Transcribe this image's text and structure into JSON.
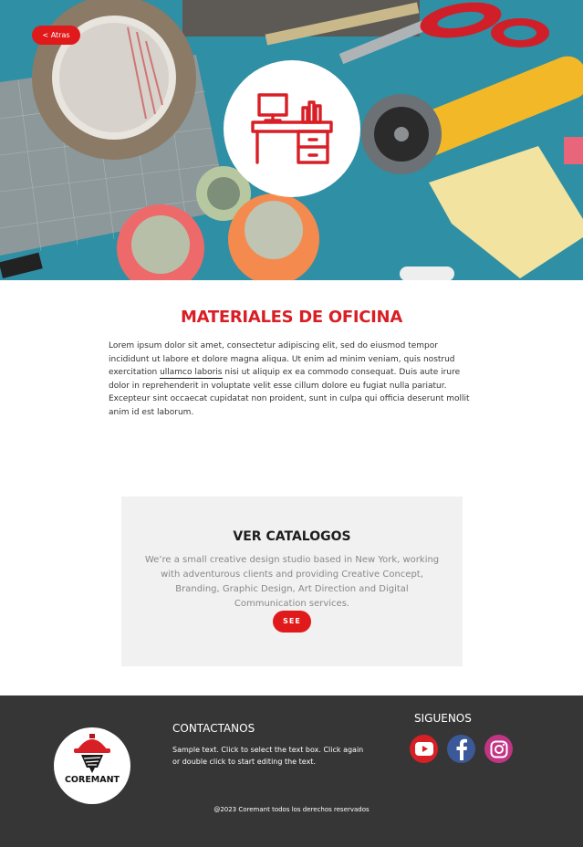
{
  "hero": {
    "back_label": "< Atras"
  },
  "content": {
    "title": "MATERIALES DE OFICINA",
    "paragraph_start": "Lorem ipsum dolor sit amet, consectetur adipiscing elit, sed do eiusmod tempor incididunt ut labore et dolore magna aliqua. Ut enim ad minim veniam, quis nostrud exercitation ",
    "paragraph_link": "ullamco laboris",
    "paragraph_end": " nisi ut aliquip ex ea commodo consequat. Duis aute irure dolor in reprehenderit in voluptate velit esse cillum dolore eu fugiat nulla pariatur. Excepteur sint occaecat cupidatat non proident, sunt in culpa qui officia deserunt mollit anim id est laborum."
  },
  "catalog": {
    "title": "VER CATALOGOS",
    "text": "We’re a small creative design studio based in New York, working with adventurous clients and providing Creative Concept, Branding, Graphic Design, Art Direction and Digital Communication services.",
    "button_label": "SEE"
  },
  "footer": {
    "logo_text": "COREMANT",
    "contact_title": "CONTACTANOS",
    "contact_text": "Sample text. Click to select the text box. Click again or double click to start editing the text.",
    "follow_title": "SIGUENOS",
    "social": [
      {
        "name": "youtube-icon",
        "color": "#d81f26"
      },
      {
        "name": "facebook-icon",
        "color": "#3b5998"
      },
      {
        "name": "instagram-icon",
        "color": "#c13584"
      }
    ],
    "copyright": "@2023 Coremant todos los derechos reservados"
  },
  "colors": {
    "accent": "#e01a1a",
    "title_red": "#d91f26",
    "footer_bg": "#363636",
    "card_bg": "#f1f1f1"
  }
}
